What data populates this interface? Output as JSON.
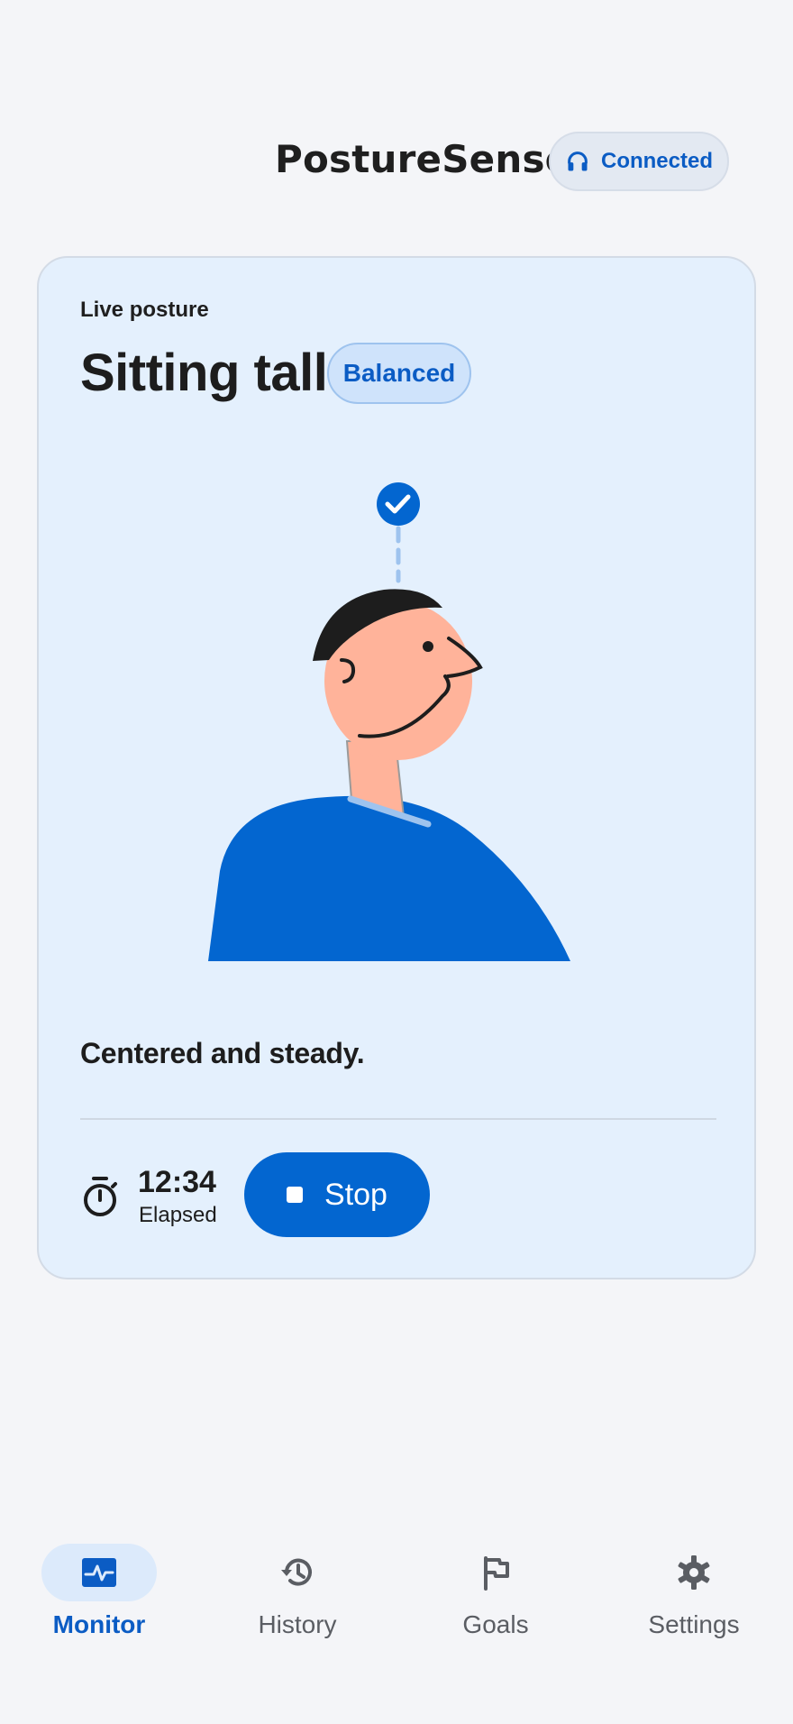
{
  "header": {
    "title": "PostureSense",
    "connection_label": "Connected"
  },
  "card": {
    "eyebrow": "Live posture",
    "headline": "Sitting tall",
    "status_pill": "Balanced",
    "feedback": "Centered and steady.",
    "timer": {
      "value": "12:34",
      "label": "Elapsed"
    },
    "stop_label": "Stop"
  },
  "nav": {
    "items": [
      {
        "label": "Monitor",
        "icon": "pulse-icon",
        "active": true
      },
      {
        "label": "History",
        "icon": "history-icon",
        "active": false
      },
      {
        "label": "Goals",
        "icon": "flag-icon",
        "active": false
      },
      {
        "label": "Settings",
        "icon": "gear-icon",
        "active": false
      }
    ]
  },
  "colors": {
    "accent": "#0366d0",
    "card_background": "#e4f0fd",
    "skin": "#ffb39a",
    "shirt": "#0366d0"
  }
}
